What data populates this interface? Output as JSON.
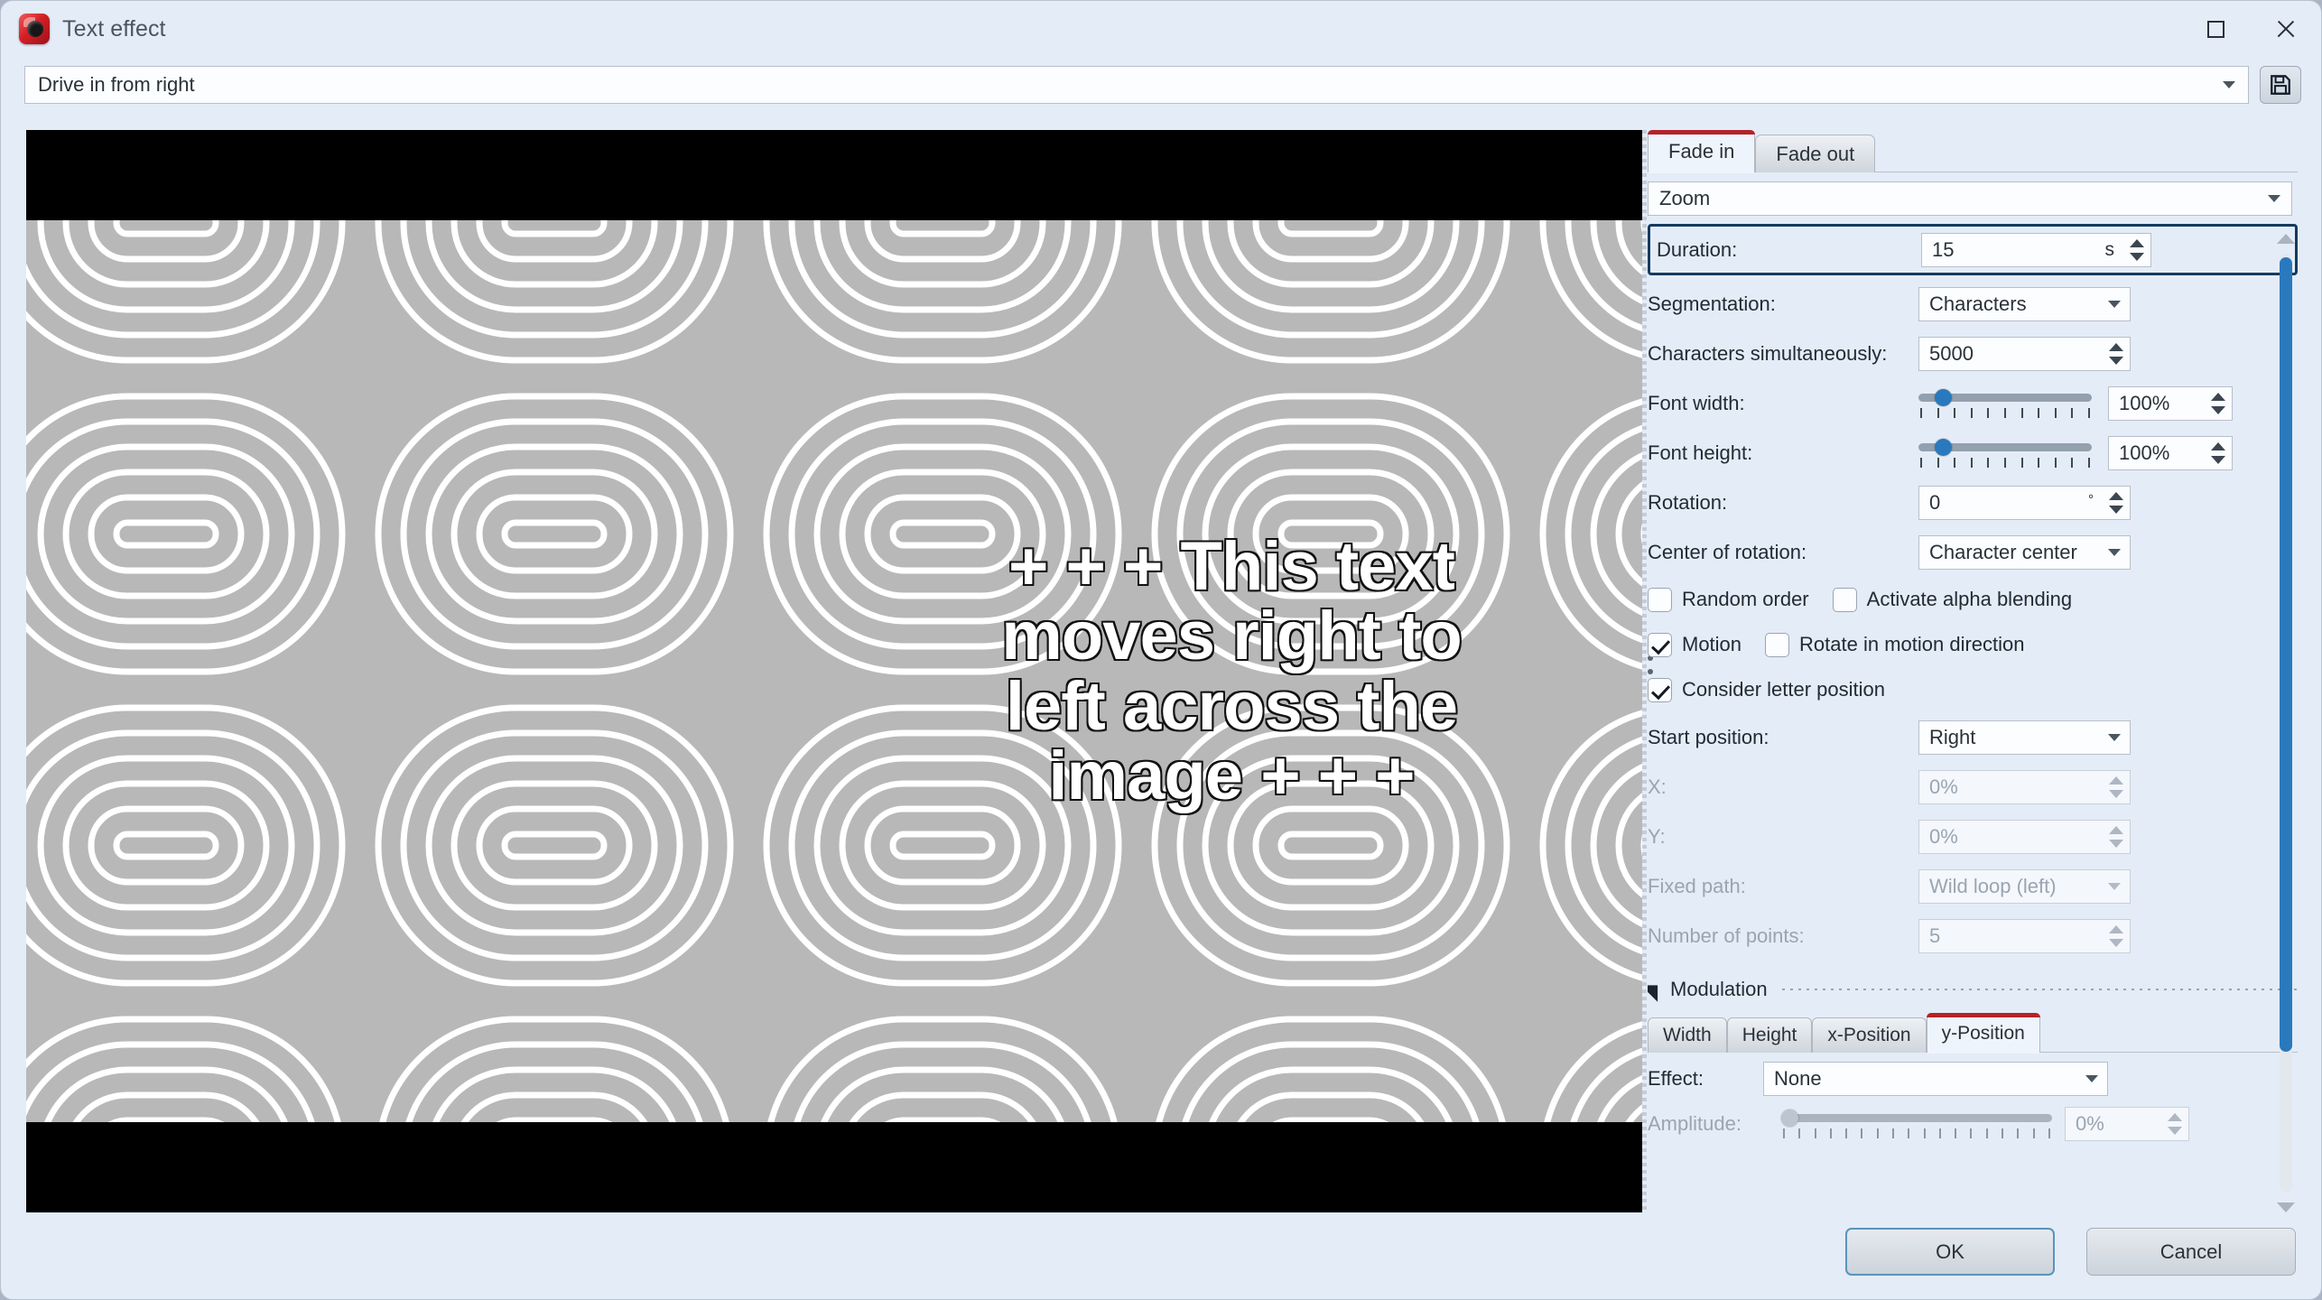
{
  "window": {
    "title": "Text effect",
    "icon": "app-icon",
    "maximize_label": "Maximize",
    "close_label": "Close"
  },
  "preset": {
    "value": "Drive in from right",
    "save_label": "Save",
    "save_icon": "floppy-disk-icon"
  },
  "preview": {
    "text": "+ + + This text moves right to left across the image + + +"
  },
  "tabs": [
    {
      "label": "Fade in",
      "active": true
    },
    {
      "label": "Fade out",
      "active": false
    }
  ],
  "effect_type": {
    "value": "Zoom"
  },
  "fields": {
    "duration": {
      "label": "Duration:",
      "value": "15",
      "unit": "s",
      "highlighted": true
    },
    "segmentation": {
      "label": "Segmentation:",
      "value": "Characters"
    },
    "chars_simultaneously": {
      "label": "Characters simultaneously:",
      "value": "5000"
    },
    "font_width": {
      "label": "Font width:",
      "value": "100%",
      "slider_percent": 10
    },
    "font_height": {
      "label": "Font height:",
      "value": "100%",
      "slider_percent": 10
    },
    "rotation": {
      "label": "Rotation:",
      "value": "0",
      "unit": "°"
    },
    "center_of_rotation": {
      "label": "Center of rotation:",
      "value": "Character center"
    },
    "start_position": {
      "label": "Start position:",
      "value": "Right"
    },
    "x": {
      "label": "X:",
      "value": "0%",
      "disabled": true
    },
    "y": {
      "label": "Y:",
      "value": "0%",
      "disabled": true
    },
    "fixed_path": {
      "label": "Fixed path:",
      "value": "Wild loop (left)",
      "disabled": true
    },
    "number_of_points": {
      "label": "Number of points:",
      "value": "5",
      "disabled": true
    }
  },
  "checkboxes": {
    "random_order": {
      "label": "Random order",
      "checked": false
    },
    "alpha_blending": {
      "label": "Activate alpha blending",
      "checked": false
    },
    "motion": {
      "label": "Motion",
      "checked": true
    },
    "rotate_in_motion": {
      "label": "Rotate in motion direction",
      "checked": false
    },
    "consider_letter_position": {
      "label": "Consider letter position",
      "checked": true
    }
  },
  "modulation": {
    "title": "Modulation",
    "tabs": [
      {
        "label": "Width",
        "active": false
      },
      {
        "label": "Height",
        "active": false
      },
      {
        "label": "x-Position",
        "active": false
      },
      {
        "label": "y-Position",
        "active": true
      }
    ],
    "effect": {
      "label": "Effect:",
      "value": "None"
    },
    "amplitude": {
      "label": "Amplitude:",
      "value": "0%",
      "slider_percent": 0,
      "disabled": true
    }
  },
  "footer": {
    "ok": "OK",
    "cancel": "Cancel"
  },
  "colors": {
    "accent_blue": "#2a79bd",
    "tab_red": "#b4232a",
    "highlight_navy": "#153a5e",
    "panel_bg": "#e4ecf7"
  }
}
